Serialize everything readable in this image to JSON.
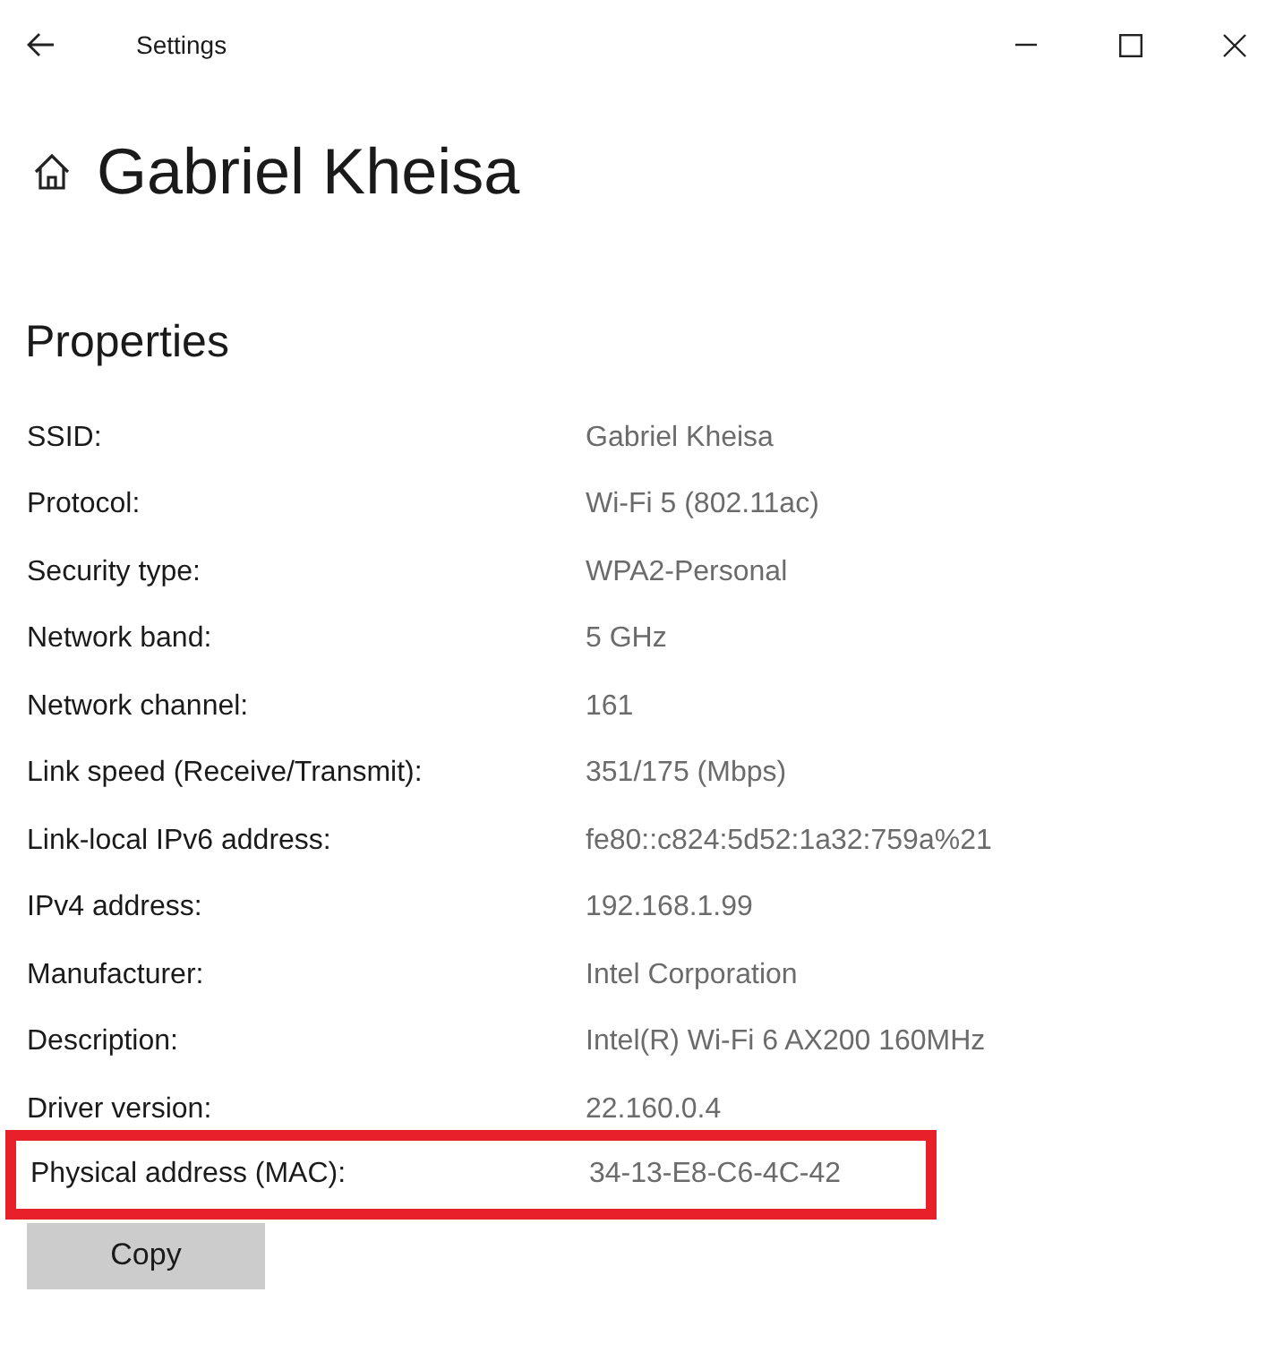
{
  "window": {
    "title": "Settings"
  },
  "page_title": "Gabriel Kheisa",
  "section_title": "Properties",
  "properties": [
    {
      "label": "SSID:",
      "value": "Gabriel Kheisa",
      "highlighted": false
    },
    {
      "label": "Protocol:",
      "value": "Wi-Fi 5 (802.11ac)",
      "highlighted": false
    },
    {
      "label": "Security type:",
      "value": "WPA2-Personal",
      "highlighted": false
    },
    {
      "label": "Network band:",
      "value": "5 GHz",
      "highlighted": false
    },
    {
      "label": "Network channel:",
      "value": "161",
      "highlighted": false
    },
    {
      "label": "Link speed (Receive/Transmit):",
      "value": "351/175 (Mbps)",
      "highlighted": false
    },
    {
      "label": "Link-local IPv6 address:",
      "value": "fe80::c824:5d52:1a32:759a%21",
      "highlighted": false
    },
    {
      "label": "IPv4 address:",
      "value": "192.168.1.99",
      "highlighted": false
    },
    {
      "label": "Manufacturer:",
      "value": "Intel Corporation",
      "highlighted": false
    },
    {
      "label": "Description:",
      "value": "Intel(R) Wi-Fi 6 AX200 160MHz",
      "highlighted": false
    },
    {
      "label": "Driver version:",
      "value": "22.160.0.4",
      "highlighted": false
    },
    {
      "label": "Physical address (MAC):",
      "value": "34-13-E8-C6-4C-42",
      "highlighted": true
    }
  ],
  "copy_button": "Copy"
}
